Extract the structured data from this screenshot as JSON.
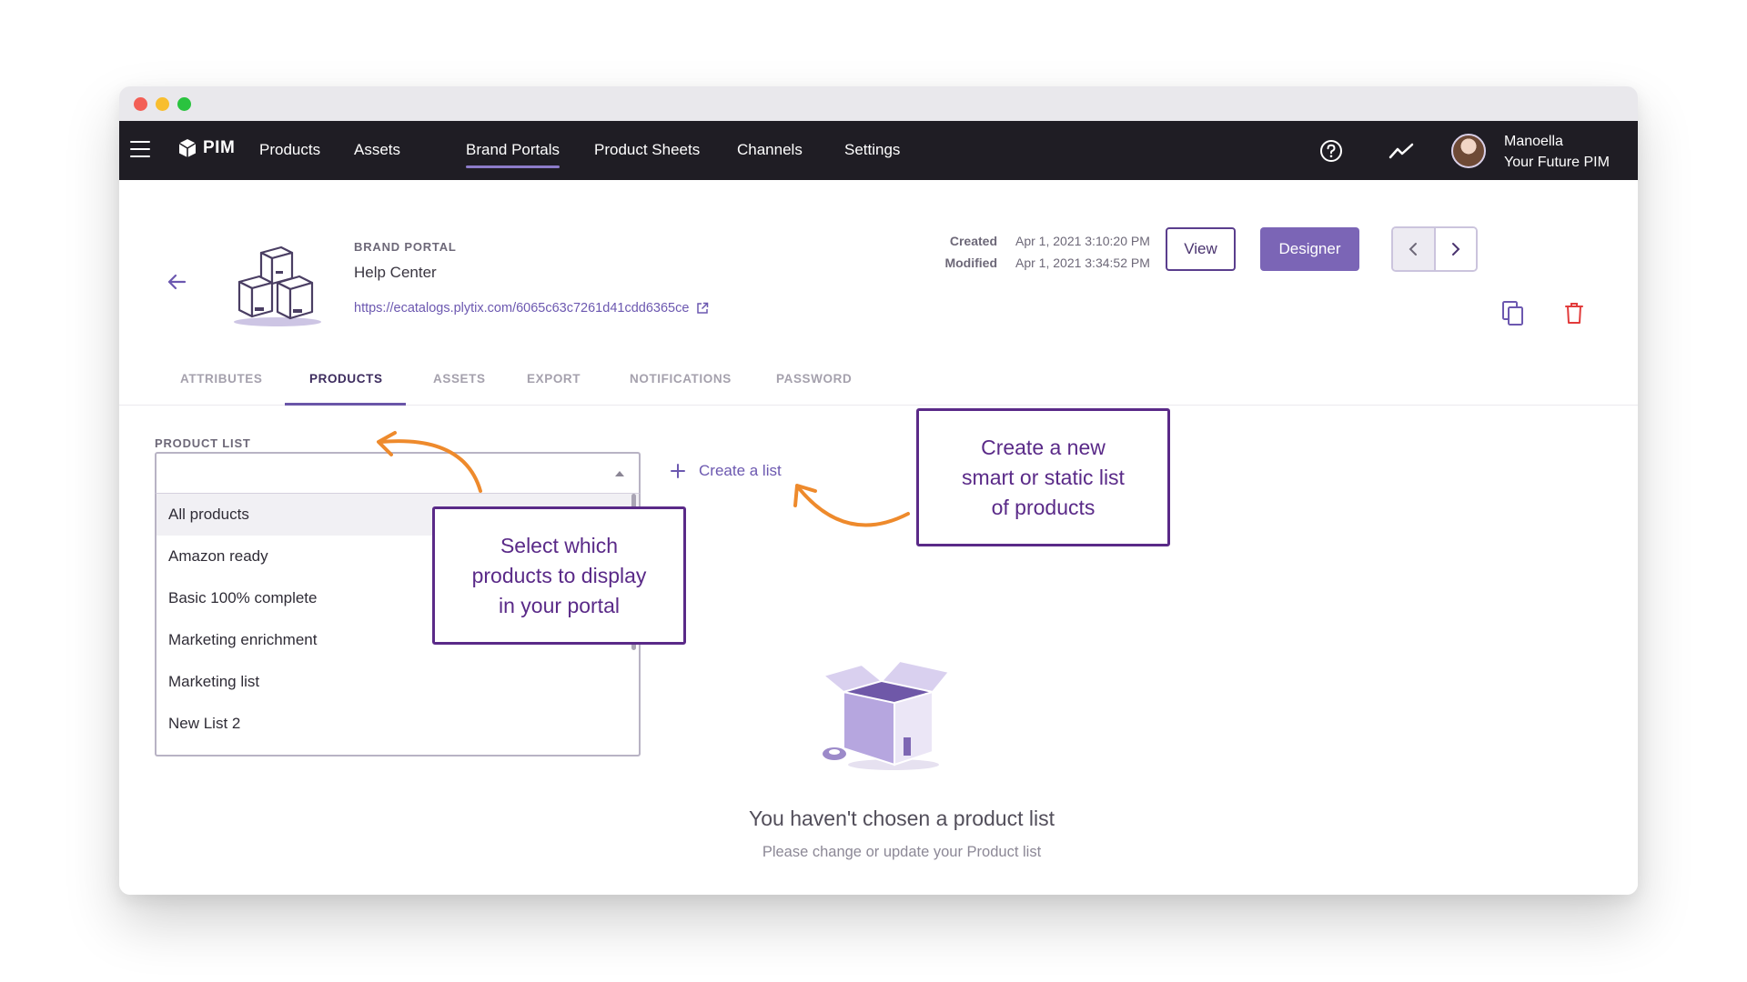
{
  "app": {
    "logo_text": "PIM",
    "nav": {
      "products": "Products",
      "assets": "Assets",
      "brand_portals": "Brand Portals",
      "product_sheets": "Product Sheets",
      "channels": "Channels",
      "settings": "Settings"
    },
    "user": {
      "name": "Manoella",
      "org": "Your Future PIM"
    }
  },
  "portal": {
    "section_label": "BRAND PORTAL",
    "name": "Help Center",
    "url": "https://ecatalogs.plytix.com/6065c63c7261d41cdd6365ce",
    "created_label": "Created",
    "created_value": "Apr 1, 2021 3:10:20 PM",
    "modified_label": "Modified",
    "modified_value": "Apr 1, 2021 3:34:52 PM",
    "view_label": "View",
    "designer_label": "Designer"
  },
  "tabs": {
    "attributes": "ATTRIBUTES",
    "products": "PRODUCTS",
    "assets": "ASSETS",
    "export": "EXPORT",
    "notifications": "NOTIFICATIONS",
    "password": "PASSWORD"
  },
  "product_list": {
    "label": "PRODUCT LIST",
    "selected_value": "",
    "options": [
      "All products",
      "Amazon ready",
      "Basic 100% complete",
      "Marketing enrichment",
      "Marketing list",
      "New List 2"
    ],
    "create_label": "Create a list"
  },
  "callouts": {
    "select": [
      "Select which",
      "products to display",
      "in your portal"
    ],
    "create": [
      "Create a new",
      "smart or static list",
      "of products"
    ]
  },
  "empty_state": {
    "title": "You haven't chosen a product list",
    "subtitle": "Please change or update your Product list"
  },
  "colors": {
    "navbar": "#1f1d24",
    "accent": "#7b65b6",
    "callout_border": "#5a2a88",
    "annotation_arrow": "#ee8a2c",
    "delete_icon": "#e23b3b"
  }
}
